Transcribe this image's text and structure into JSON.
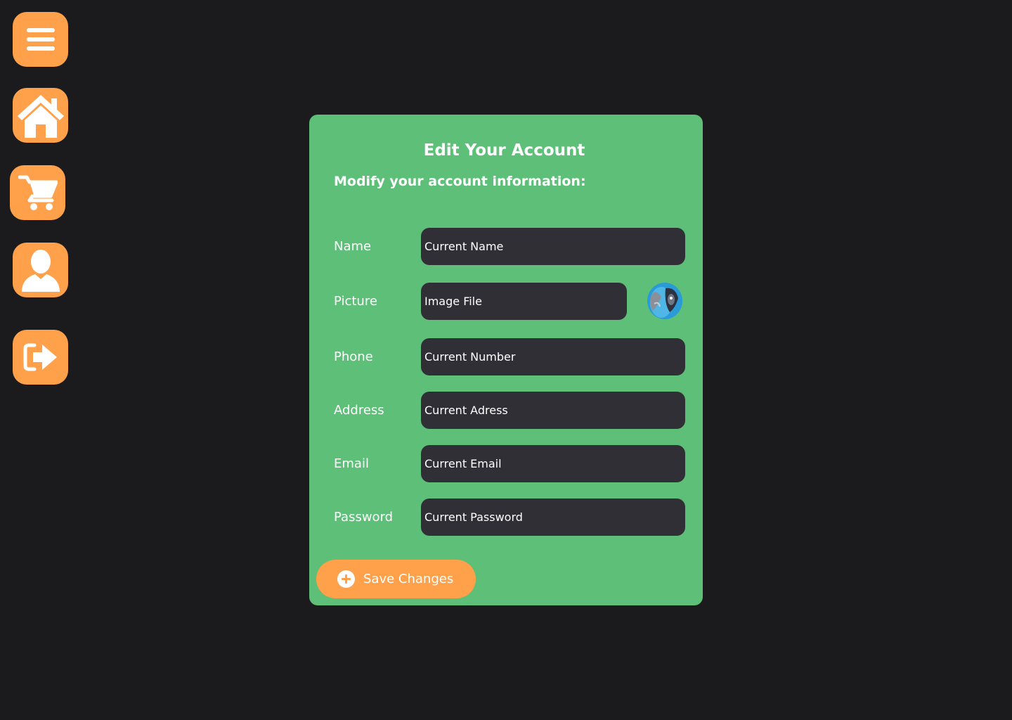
{
  "sidebar": {
    "items": [
      {
        "id": "menu",
        "icon": "hamburger-menu-icon"
      },
      {
        "id": "home",
        "icon": "home-icon"
      },
      {
        "id": "cart",
        "icon": "shopping-cart-icon"
      },
      {
        "id": "profile",
        "icon": "user-icon"
      },
      {
        "id": "logout",
        "icon": "logout-icon"
      }
    ]
  },
  "form": {
    "title": "Edit Your Account",
    "subtitle": "Modify your account information:",
    "fields": {
      "name": {
        "label": "Name",
        "placeholder": "Current Name"
      },
      "picture": {
        "label": "Picture",
        "placeholder": "Image File"
      },
      "phone": {
        "label": "Phone",
        "placeholder": "Current Number"
      },
      "address": {
        "label": "Address",
        "placeholder": "Current Adress"
      },
      "email": {
        "label": "Email",
        "placeholder": "Current Email"
      },
      "password": {
        "label": "Password",
        "placeholder": "Current Password"
      }
    },
    "save_label": "Save Changes"
  },
  "colors": {
    "background": "#1b1b1d",
    "accent": "#ffa04a",
    "card": "#5ebf78",
    "input": "#302f36",
    "text": "#ffffff"
  }
}
